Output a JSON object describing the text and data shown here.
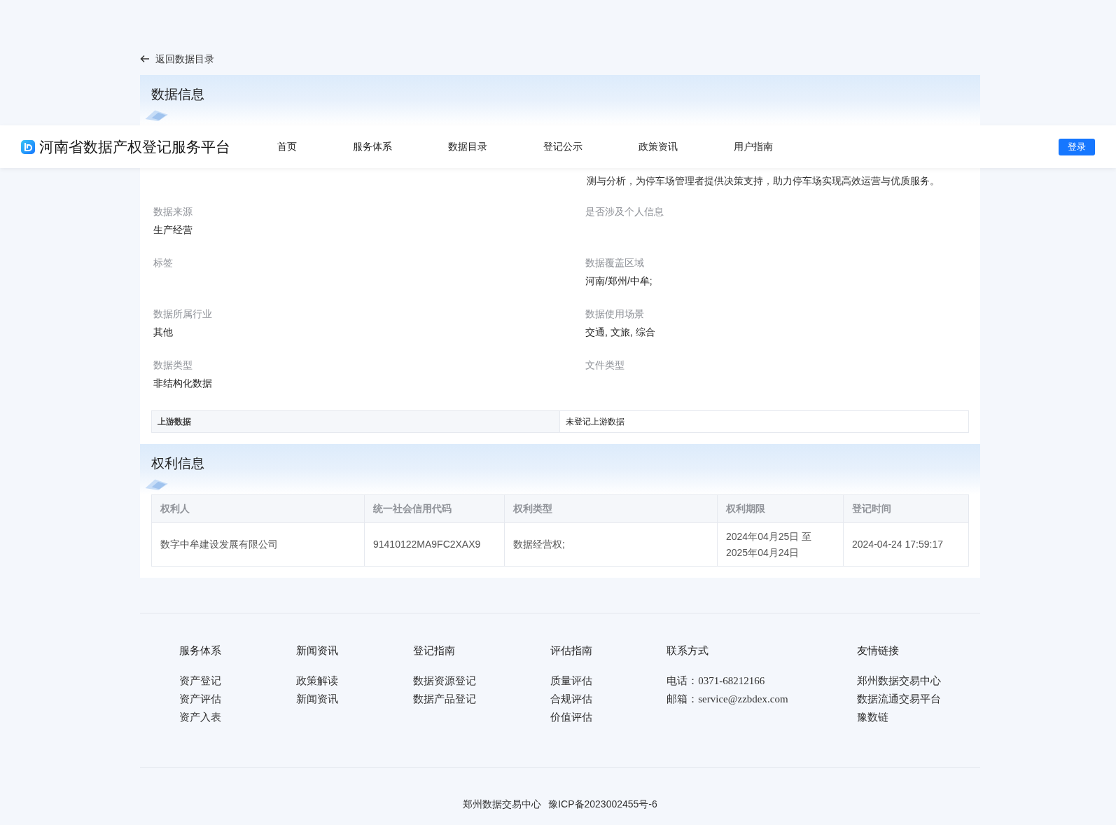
{
  "back_link": {
    "label": "返回数据目录"
  },
  "header": {
    "logo_text": "河南省数据产权登记服务平台",
    "nav": [
      "首页",
      "服务体系",
      "数据目录",
      "登记公示",
      "政策资讯",
      "用户指南"
    ],
    "login": "登录"
  },
  "data_info": {
    "title": "数据信息",
    "description_tail": "测与分析，为停车场管理者提供决策支持，助力停车场实现高效运营与优质服务。",
    "fields": [
      {
        "label": "数据来源",
        "value": "生产经营"
      },
      {
        "label": "是否涉及个人信息"
      },
      {
        "label": "标签"
      },
      {
        "label": "数据覆盖区域",
        "value": "河南/郑州/中牟;"
      },
      {
        "label": "数据所属行业",
        "value": "其他"
      },
      {
        "label": "数据使用场景",
        "value": "交通, 文旅, 综合"
      },
      {
        "label": "数据类型",
        "value": "非结构化数据"
      },
      {
        "label": "文件类型"
      }
    ],
    "upstream": {
      "label": "上游数据",
      "value": "未登记上游数据"
    }
  },
  "rights_info": {
    "title": "权利信息",
    "columns": [
      "权利人",
      "统一社会信用代码",
      "权利类型",
      "权利期限",
      "登记时间"
    ],
    "rows": [
      [
        "数字中牟建设发展有限公司",
        "91410122MA9FC2XAX9",
        "数据经营权;",
        "2024年04月25日 至 2025年04月24日",
        "2024-04-24 17:59:17"
      ]
    ]
  },
  "footer": {
    "columns": [
      {
        "heading": "服务体系",
        "links": [
          "资产登记",
          "资产评估",
          "资产入表"
        ]
      },
      {
        "heading": "新闻资讯",
        "links": [
          "政策解读",
          "新闻资讯"
        ]
      },
      {
        "heading": "登记指南",
        "links": [
          "数据资源登记",
          "数据产品登记"
        ]
      },
      {
        "heading": "评估指南",
        "links": [
          "质量评估",
          "合规评估",
          "价值评估"
        ]
      }
    ],
    "contact": {
      "heading": "联系方式",
      "items": [
        {
          "label": "电话：",
          "value": "0371-68212166"
        },
        {
          "label": "邮箱：",
          "value": "service@zzbdex.com"
        }
      ]
    },
    "friends": {
      "heading": "友情链接",
      "links": [
        "郑州数据交易中心",
        "数据流通交易平台",
        "豫数链"
      ]
    },
    "copyright": [
      "郑州数据交易中心",
      "豫ICP备2023002455号-6"
    ]
  }
}
